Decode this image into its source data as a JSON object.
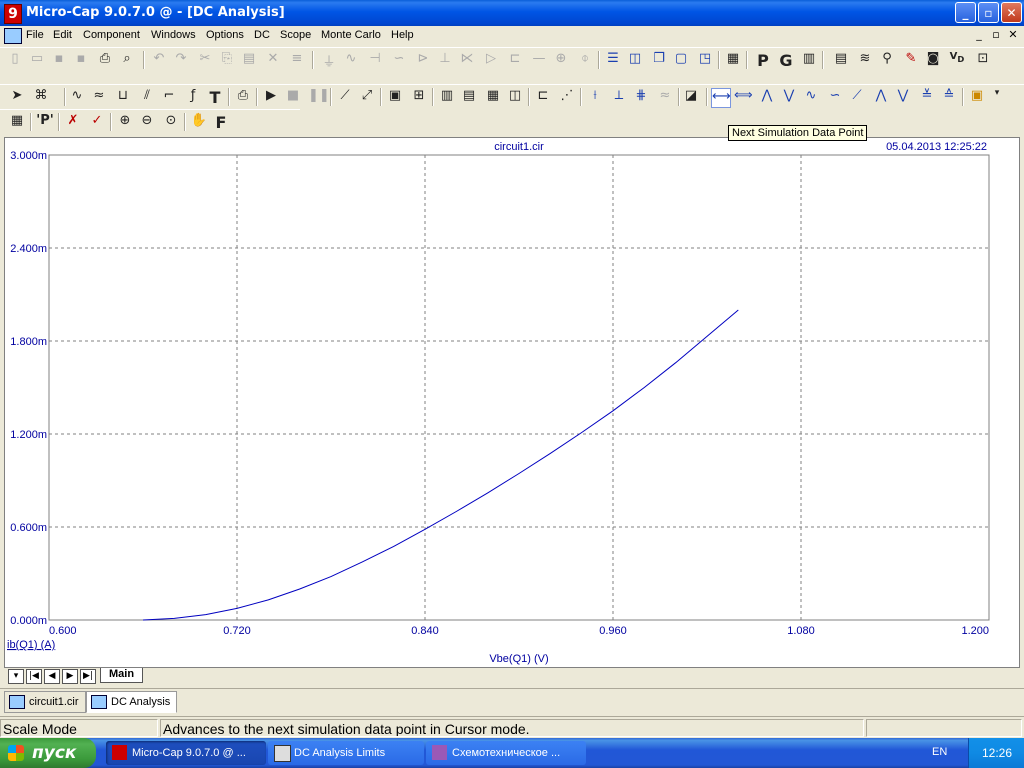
{
  "window": {
    "title": "Micro-Cap 9.0.7.0 @ - [DC Analysis]",
    "app_icon_glyph": "9",
    "controls": {
      "minimize": "_",
      "restore": "▫",
      "close": "✕"
    }
  },
  "menu": {
    "items": [
      "File",
      "Edit",
      "Component",
      "Windows",
      "Options",
      "DC",
      "Scope",
      "Monte Carlo",
      "Help"
    ],
    "mdi_controls": {
      "minimize": "_",
      "restore": "▫",
      "close": "✕"
    }
  },
  "tooltip": {
    "text": "Next Simulation Data Point"
  },
  "plot": {
    "filename": "circuit1.cir",
    "timestamp": "05.04.2013 12:25:22",
    "y_axis_name": "ib(Q1) (A)",
    "x_axis_name": "Vbe(Q1) (V)"
  },
  "chart_data": {
    "type": "line",
    "xlabel": "Vbe(Q1) (V)",
    "ylabel": "ib(Q1) (A)",
    "xlim": [
      0.6,
      1.2
    ],
    "ylim": [
      0,
      3.0
    ],
    "y_unit": "m",
    "x_ticks": [
      "0.600",
      "0.720",
      "0.840",
      "0.960",
      "1.080",
      "1.200"
    ],
    "y_ticks": [
      "0.000m",
      "0.600m",
      "1.200m",
      "1.800m",
      "2.400m",
      "3.000m"
    ],
    "grid": true,
    "series": [
      {
        "color": "#0000c0",
        "x": [
          0.66,
          0.68,
          0.7,
          0.72,
          0.74,
          0.76,
          0.78,
          0.8,
          0.82,
          0.84,
          0.86,
          0.88,
          0.9,
          0.92,
          0.94,
          0.96,
          0.98,
          1.0,
          1.02,
          1.04
        ],
        "y": [
          0.0,
          0.01,
          0.035,
          0.075,
          0.13,
          0.2,
          0.28,
          0.375,
          0.475,
          0.585,
          0.7,
          0.82,
          0.945,
          1.075,
          1.21,
          1.35,
          1.5,
          1.66,
          1.83,
          2.0
        ]
      }
    ]
  },
  "nav": {
    "main_tab": "Main",
    "buttons": [
      "▾",
      "|◀",
      "◀",
      "▶",
      "▶|"
    ]
  },
  "doc_tabs": [
    {
      "label": "circuit1.cir",
      "active": false
    },
    {
      "label": "DC Analysis",
      "active": true
    }
  ],
  "status": {
    "mode": "Scale Mode",
    "hint": "Advances to the next simulation data point in Cursor mode."
  },
  "taskbar": {
    "start_label": "пуск",
    "buttons": [
      {
        "label": "Micro-Cap 9.0.7.0 @ ...",
        "active": true
      },
      {
        "label": "DC Analysis Limits",
        "active": false
      },
      {
        "label": "Схемотехническое ...",
        "active": false
      }
    ],
    "language": "EN",
    "clock": "12:26"
  }
}
